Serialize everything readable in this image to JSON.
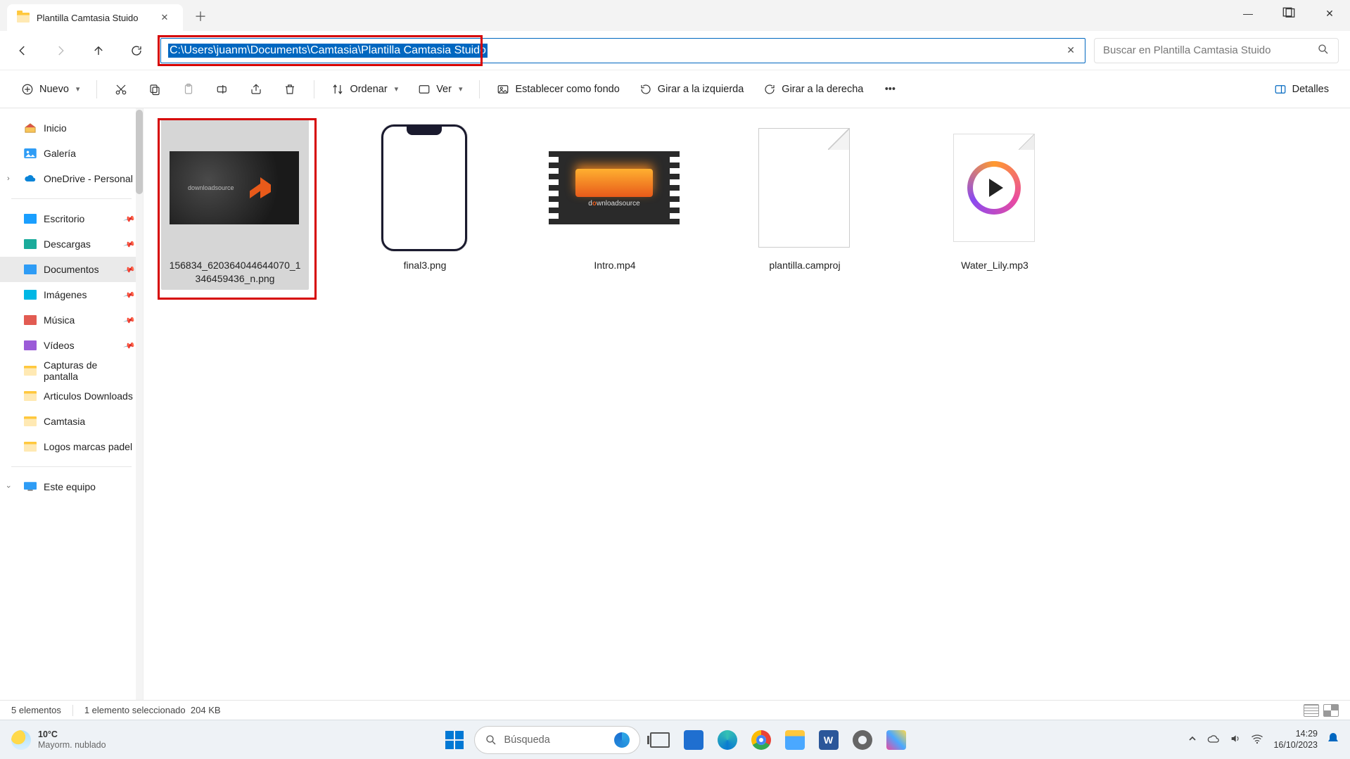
{
  "tab": {
    "title": "Plantilla Camtasia Stuido"
  },
  "address": {
    "path": "C:\\Users\\juanm\\Documents\\Camtasia\\Plantilla Camtasia Stuido"
  },
  "search": {
    "placeholder": "Buscar en Plantilla Camtasia Stuido"
  },
  "toolbar": {
    "new": "Nuevo",
    "sort": "Ordenar",
    "view": "Ver",
    "background": "Establecer como fondo",
    "rotate_left": "Girar a la izquierda",
    "rotate_right": "Girar a la derecha",
    "details": "Detalles"
  },
  "sidebar": {
    "home": "Inicio",
    "gallery": "Galería",
    "onedrive": "OneDrive - Personal",
    "desktop": "Escritorio",
    "downloads": "Descargas",
    "documents": "Documentos",
    "pictures": "Imágenes",
    "music": "Música",
    "videos": "Vídeos",
    "screenshots": "Capturas de pantalla",
    "articles": "Articulos Downloads",
    "camtasia": "Camtasia",
    "logos": "Logos marcas padel",
    "thispc": "Este equipo"
  },
  "files": [
    {
      "name": "156834_620364044644070_1346459436_n.png"
    },
    {
      "name": "final3.png"
    },
    {
      "name": "Intro.mp4"
    },
    {
      "name": "plantilla.camproj"
    },
    {
      "name": "Water_Lily.mp3"
    }
  ],
  "status": {
    "count": "5 elementos",
    "selected": "1 elemento seleccionado",
    "size": "204 KB"
  },
  "taskbar": {
    "temp": "10°C",
    "weather": "Mayorm. nublado",
    "search": "Búsqueda",
    "time": "14:29",
    "date": "16/10/2023"
  },
  "thumb_text": {
    "downloadsource": "downloadsource",
    "ds_html": "source"
  }
}
